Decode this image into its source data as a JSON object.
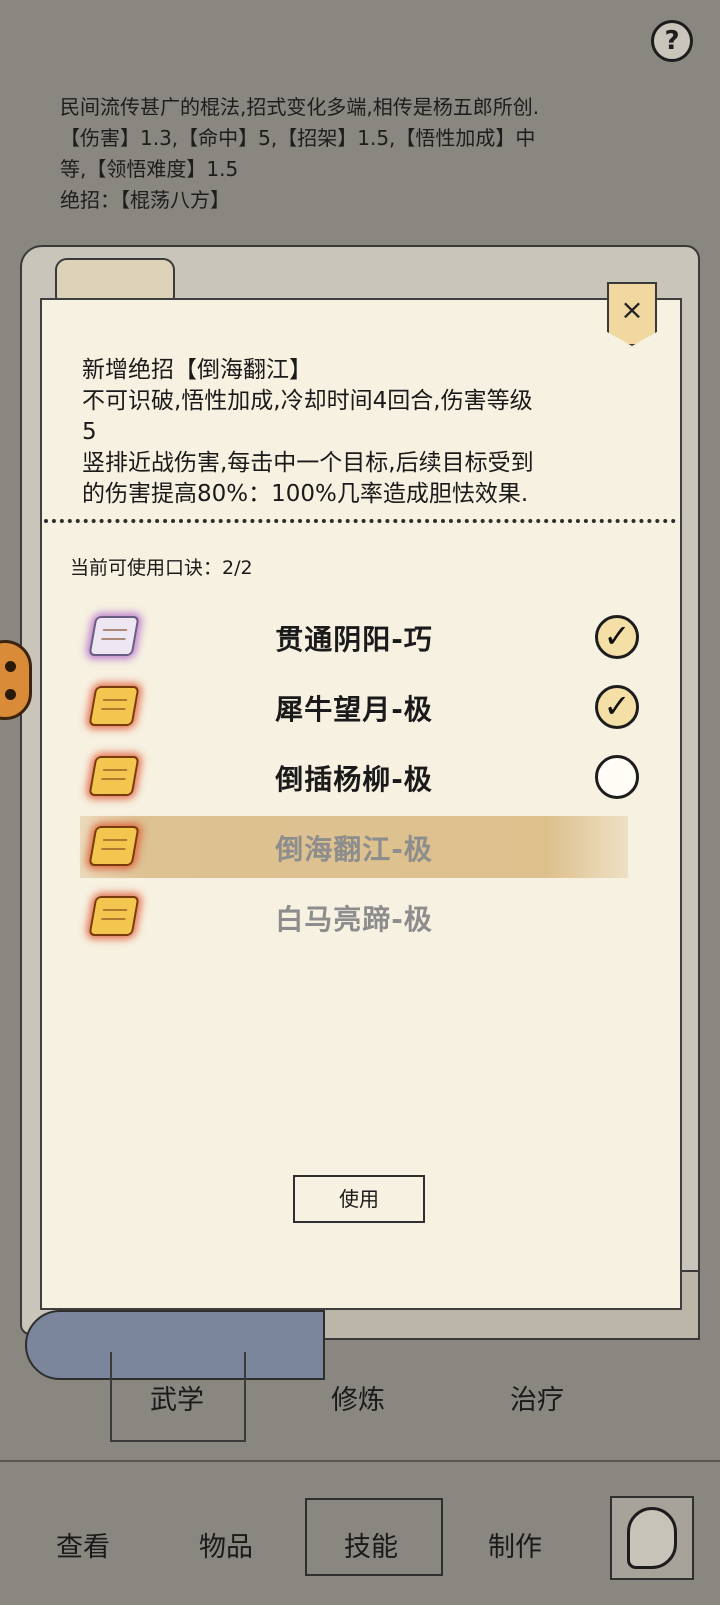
{
  "help": {
    "label": "?"
  },
  "description": {
    "lines": [
      "民间流传甚广的棍法,招式变化多端,相传是杨五郎所创.",
      "【伤害】1.3,【命中】5,【招架】1.5,【悟性加成】中",
      "等,【领悟难度】1.5",
      "绝招：【棍荡八方】"
    ]
  },
  "dialog": {
    "close_label": "×",
    "new_move_lines": [
      "新增绝招【倒海翻江】",
      "不可识破,悟性加成,冷却时间4回合,伤害等级",
      "5",
      "竖排近战伤害,每击中一个目标,后续目标受到",
      "的伤害提高80%：100%几率造成胆怯效果."
    ],
    "usage_text": "当前可使用口诀：2/2",
    "skills": [
      {
        "icon": "silver-scroll-icon",
        "name": "贯通阴阳-巧",
        "checked": true
      },
      {
        "icon": "gold-scroll-icon",
        "name": "犀牛望月-极",
        "checked": true
      },
      {
        "icon": "gold-scroll-icon",
        "name": "倒插杨柳-极",
        "checked": false
      },
      {
        "icon": "gold-scroll-icon",
        "name": "倒海翻江-极",
        "checked": null
      },
      {
        "icon": "gold-scroll-icon",
        "name": "白马亮蹄-极",
        "checked": null
      }
    ],
    "check_mark": "✓",
    "use_button": "使用"
  },
  "sub_tabs": [
    "武学",
    "修炼",
    "治疗"
  ],
  "nav": [
    "查看",
    "物品",
    "技能",
    "制作"
  ]
}
